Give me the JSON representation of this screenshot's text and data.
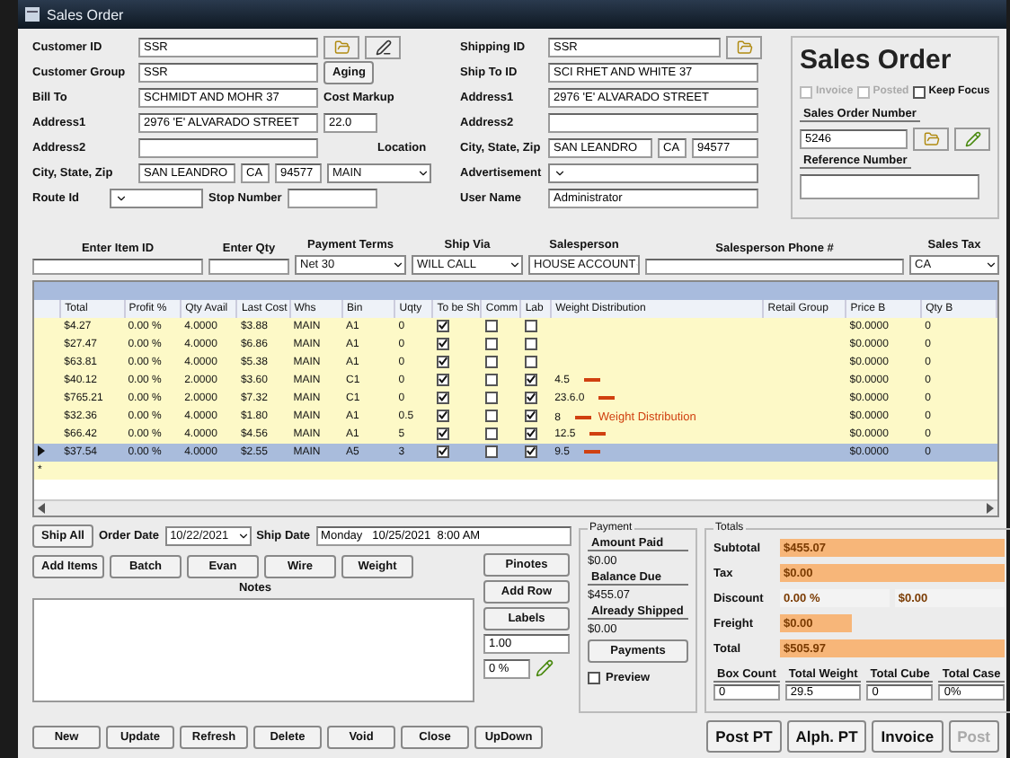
{
  "window": {
    "title": "Sales Order"
  },
  "customer": {
    "fields": [
      {
        "label": "Customer ID",
        "value": "SSR"
      },
      {
        "label": "Customer Group",
        "value": "SSR"
      },
      {
        "label": "Bill To",
        "value": "SCHMIDT AND MOHR 37"
      },
      {
        "label": "Address1",
        "value": "2976 'E' ALVARADO STREET"
      },
      {
        "label": "Address2"
      }
    ],
    "city_label": "City, State, Zip",
    "city": "SAN LEANDRO",
    "state": "CA",
    "zip": "94577",
    "route_label": "Route Id",
    "stop_label": "Stop Number"
  },
  "aging_button": "Aging",
  "cost_markup": {
    "label": "Cost Markup",
    "value": "22.0"
  },
  "location": {
    "label": "Location",
    "value": "MAIN"
  },
  "shipping": {
    "fields": [
      {
        "label": "Shipping ID",
        "value": "SSR",
        "kind": "lookup"
      },
      {
        "label": "Ship To ID",
        "value": "SCI RHET AND WHITE 37",
        "kind": "text"
      },
      {
        "label": "Address1",
        "value": "2976 'E' ALVARADO STREET",
        "kind": "text"
      },
      {
        "label": "Address2",
        "kind": "text"
      },
      {
        "label": "City, State, Zip",
        "value": "SAN LEANDRO",
        "state": "CA",
        "zip": "94577",
        "kind": "city"
      },
      {
        "label": "Advertisement",
        "kind": "dropdown"
      },
      {
        "label": "User Name",
        "value": "Administrator",
        "kind": "text"
      }
    ]
  },
  "order_panel": {
    "title": "Sales Order",
    "options": [
      {
        "label": "Invoice",
        "checked": false,
        "disabled": true
      },
      {
        "label": "Posted",
        "checked": false,
        "disabled": true
      },
      {
        "label": "Keep Focus",
        "checked": false,
        "disabled": false
      }
    ],
    "number_label": "Sales Order Number",
    "number": "5246",
    "reference_label": "Reference Number"
  },
  "entry": {
    "item_label": "Enter Item ID",
    "qty_label": "Enter Qty",
    "terms": {
      "label": "Payment Terms",
      "value": "Net 30"
    },
    "ship_via": {
      "label": "Ship Via",
      "value": "WILL CALL"
    },
    "salesperson": {
      "label": "Salesperson",
      "value": "HOUSE ACCOUNT"
    },
    "phone_label": "Salesperson Phone #",
    "tax": {
      "label": "Sales Tax",
      "value": "CA"
    }
  },
  "table": {
    "columns": [
      "Total",
      "Profit %",
      "Qty Avail",
      "Last Cost",
      "Whs",
      "Bin",
      "Uqty",
      "To be Sh",
      "Comm",
      "Lab",
      "Weight Distribution",
      "Retail Group",
      "Price B",
      "Qty B"
    ],
    "rows": [
      {
        "cells": [
          "$4.27",
          "0.00 %",
          "4.0000",
          "$3.88",
          "MAIN",
          "A1",
          "0"
        ],
        "to_ship": true,
        "comm": false,
        "lab": false,
        "flag": false,
        "price": "$0.0000",
        "qty_b": "0",
        "selected": false
      },
      {
        "cells": [
          "$27.47",
          "0.00 %",
          "4.0000",
          "$6.86",
          "MAIN",
          "A1",
          "0"
        ],
        "to_ship": true,
        "comm": false,
        "lab": false,
        "flag": false,
        "price": "$0.0000",
        "qty_b": "0",
        "selected": false
      },
      {
        "cells": [
          "$63.81",
          "0.00 %",
          "4.0000",
          "$5.38",
          "MAIN",
          "A1",
          "0"
        ],
        "to_ship": true,
        "comm": false,
        "lab": false,
        "flag": false,
        "price": "$0.0000",
        "qty_b": "0",
        "selected": false
      },
      {
        "cells": [
          "$40.12",
          "0.00 %",
          "2.0000",
          "$3.60",
          "MAIN",
          "C1",
          "0"
        ],
        "to_ship": true,
        "comm": false,
        "lab": true,
        "weight": "4.5",
        "flag": true,
        "price": "$0.0000",
        "qty_b": "0",
        "selected": false
      },
      {
        "cells": [
          "$765.21",
          "0.00 %",
          "2.0000",
          "$7.32",
          "MAIN",
          "C1",
          "0"
        ],
        "to_ship": true,
        "comm": false,
        "lab": true,
        "weight": "23.6.0",
        "flag": true,
        "price": "$0.0000",
        "qty_b": "0",
        "selected": false
      },
      {
        "cells": [
          "$32.36",
          "0.00 %",
          "4.0000",
          "$1.80",
          "MAIN",
          "A1",
          "0.5"
        ],
        "to_ship": true,
        "comm": false,
        "lab": true,
        "weight": "8",
        "flag": true,
        "note": "Weight Distribution",
        "price": "$0.0000",
        "qty_b": "0",
        "selected": false
      },
      {
        "cells": [
          "$66.42",
          "0.00 %",
          "4.0000",
          "$4.56",
          "MAIN",
          "A1",
          "5"
        ],
        "to_ship": true,
        "comm": false,
        "lab": true,
        "weight": "12.5",
        "flag": true,
        "price": "$0.0000",
        "qty_b": "0",
        "selected": false
      },
      {
        "cells": [
          "$37.54",
          "0.00 %",
          "4.0000",
          "$2.55",
          "MAIN",
          "A5",
          "3"
        ],
        "to_ship": true,
        "comm": false,
        "lab": true,
        "weight": "9.5",
        "flag": true,
        "price": "$0.0000",
        "qty_b": "0",
        "selected": true
      }
    ],
    "new_row_marker": "*"
  },
  "ship_all": "Ship All",
  "order_date": {
    "label": "Order Date",
    "value": "10/22/2021"
  },
  "ship_date": {
    "label": "Ship Date",
    "value": "Monday   10/25/2021  8:00 AM"
  },
  "item_buttons": [
    "Add Items",
    "Batch",
    "Evan",
    "Wire",
    "Weight"
  ],
  "notes_label": "Notes",
  "side_buttons": [
    "Pinotes",
    "Add Row",
    "Labels"
  ],
  "side_field": "1.00",
  "side_small": "0 %",
  "payment": {
    "legend": "Payment",
    "items": [
      {
        "label": "Amount Paid",
        "value": "$0.00"
      },
      {
        "label": "Balance Due",
        "value": "$455.07"
      },
      {
        "label": "Already Shipped",
        "value": "$0.00"
      }
    ],
    "button": "Payments",
    "preview": {
      "label": "Preview",
      "checked": false
    }
  },
  "totals": {
    "legend": "Totals",
    "rows": [
      {
        "label": "Subtotal",
        "kind": "amount",
        "value": "$455.07"
      },
      {
        "label": "Tax",
        "kind": "amount",
        "value": "$0.00"
      },
      {
        "label": "Discount",
        "kind": "discount",
        "value": "0.00 %",
        "value2": "$0.00"
      },
      {
        "label": "Freight",
        "kind": "short",
        "value": "$0.00"
      },
      {
        "label": "Total",
        "kind": "amount",
        "value": "$505.97"
      }
    ],
    "stats": [
      {
        "label": "Box Count",
        "value": "0"
      },
      {
        "label": "Total Weight",
        "value": "29.5"
      },
      {
        "label": "Total Cube",
        "value": "0"
      },
      {
        "label": "Total Case",
        "value": "0%"
      }
    ]
  },
  "bottom_buttons": [
    "New",
    "Update",
    "Refresh",
    "Delete",
    "Void",
    "Close",
    "UpDown"
  ],
  "print_buttons": [
    {
      "label": "Post PT",
      "disabled": false
    },
    {
      "label": "Alph. PT",
      "disabled": false
    },
    {
      "label": "Invoice",
      "disabled": false
    },
    {
      "label": "Post",
      "disabled": true
    }
  ]
}
